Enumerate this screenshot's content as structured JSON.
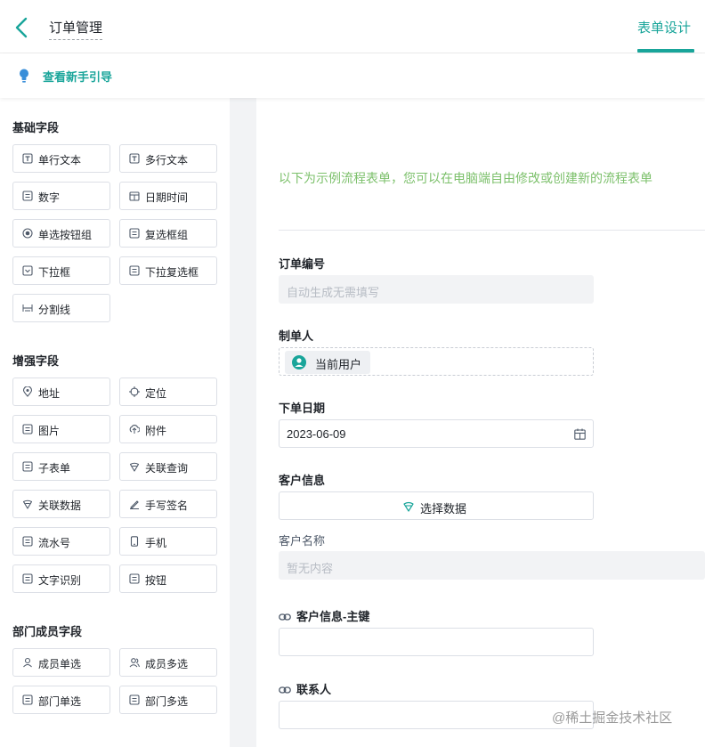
{
  "header": {
    "title": "订单管理",
    "active_tab": "表单设计"
  },
  "guide": {
    "label": "查看新手引导"
  },
  "sidebar": {
    "groups": [
      {
        "title": "基础字段",
        "items": [
          {
            "label": "单行文本",
            "icon": "text-T-icon"
          },
          {
            "label": "多行文本",
            "icon": "textarea-T-icon"
          },
          {
            "label": "数字",
            "icon": "number-icon"
          },
          {
            "label": "日期时间",
            "icon": "calendar-icon"
          },
          {
            "label": "单选按钮组",
            "icon": "radio-icon"
          },
          {
            "label": "复选框组",
            "icon": "checkbox-icon"
          },
          {
            "label": "下拉框",
            "icon": "dropdown-icon"
          },
          {
            "label": "下拉复选框",
            "icon": "multi-dropdown-icon"
          },
          {
            "label": "分割线",
            "icon": "divider-icon"
          }
        ]
      },
      {
        "title": "增强字段",
        "items": [
          {
            "label": "地址",
            "icon": "location-pin-icon"
          },
          {
            "label": "定位",
            "icon": "crosshair-icon"
          },
          {
            "label": "图片",
            "icon": "image-icon"
          },
          {
            "label": "附件",
            "icon": "cloud-upload-icon"
          },
          {
            "label": "子表单",
            "icon": "subform-icon"
          },
          {
            "label": "关联查询",
            "icon": "link-query-icon"
          },
          {
            "label": "关联数据",
            "icon": "link-data-icon"
          },
          {
            "label": "手写签名",
            "icon": "pen-icon"
          },
          {
            "label": "流水号",
            "icon": "serial-number-icon"
          },
          {
            "label": "手机",
            "icon": "mobile-icon"
          },
          {
            "label": "文字识别",
            "icon": "ocr-icon"
          },
          {
            "label": "按钮",
            "icon": "button-icon"
          }
        ]
      },
      {
        "title": "部门成员字段",
        "items": [
          {
            "label": "成员单选",
            "icon": "user-icon"
          },
          {
            "label": "成员多选",
            "icon": "users-icon"
          },
          {
            "label": "部门单选",
            "icon": "department-icon"
          },
          {
            "label": "部门多选",
            "icon": "departments-icon"
          }
        ]
      }
    ]
  },
  "form": {
    "intro": "以下为示例流程表单，您可以在电脑端自由修改或创建新的流程表单",
    "fields": {
      "order_no": {
        "label": "订单编号",
        "placeholder": "自动生成无需填写"
      },
      "creator": {
        "label": "制单人",
        "value": "当前用户"
      },
      "order_date": {
        "label": "下单日期",
        "value": "2023-06-09"
      },
      "customer_info": {
        "label": "客户信息",
        "button": "选择数据"
      },
      "customer_name": {
        "label": "客户名称",
        "placeholder": "暂无内容"
      },
      "customer_key": {
        "label": "客户信息-主键"
      },
      "contact": {
        "label": "联系人"
      }
    }
  },
  "watermark": "@稀土掘金技术社区",
  "colors": {
    "accent": "#19a59a",
    "intro_green": "#7cc06b",
    "gutter": "#f2f3f5"
  }
}
